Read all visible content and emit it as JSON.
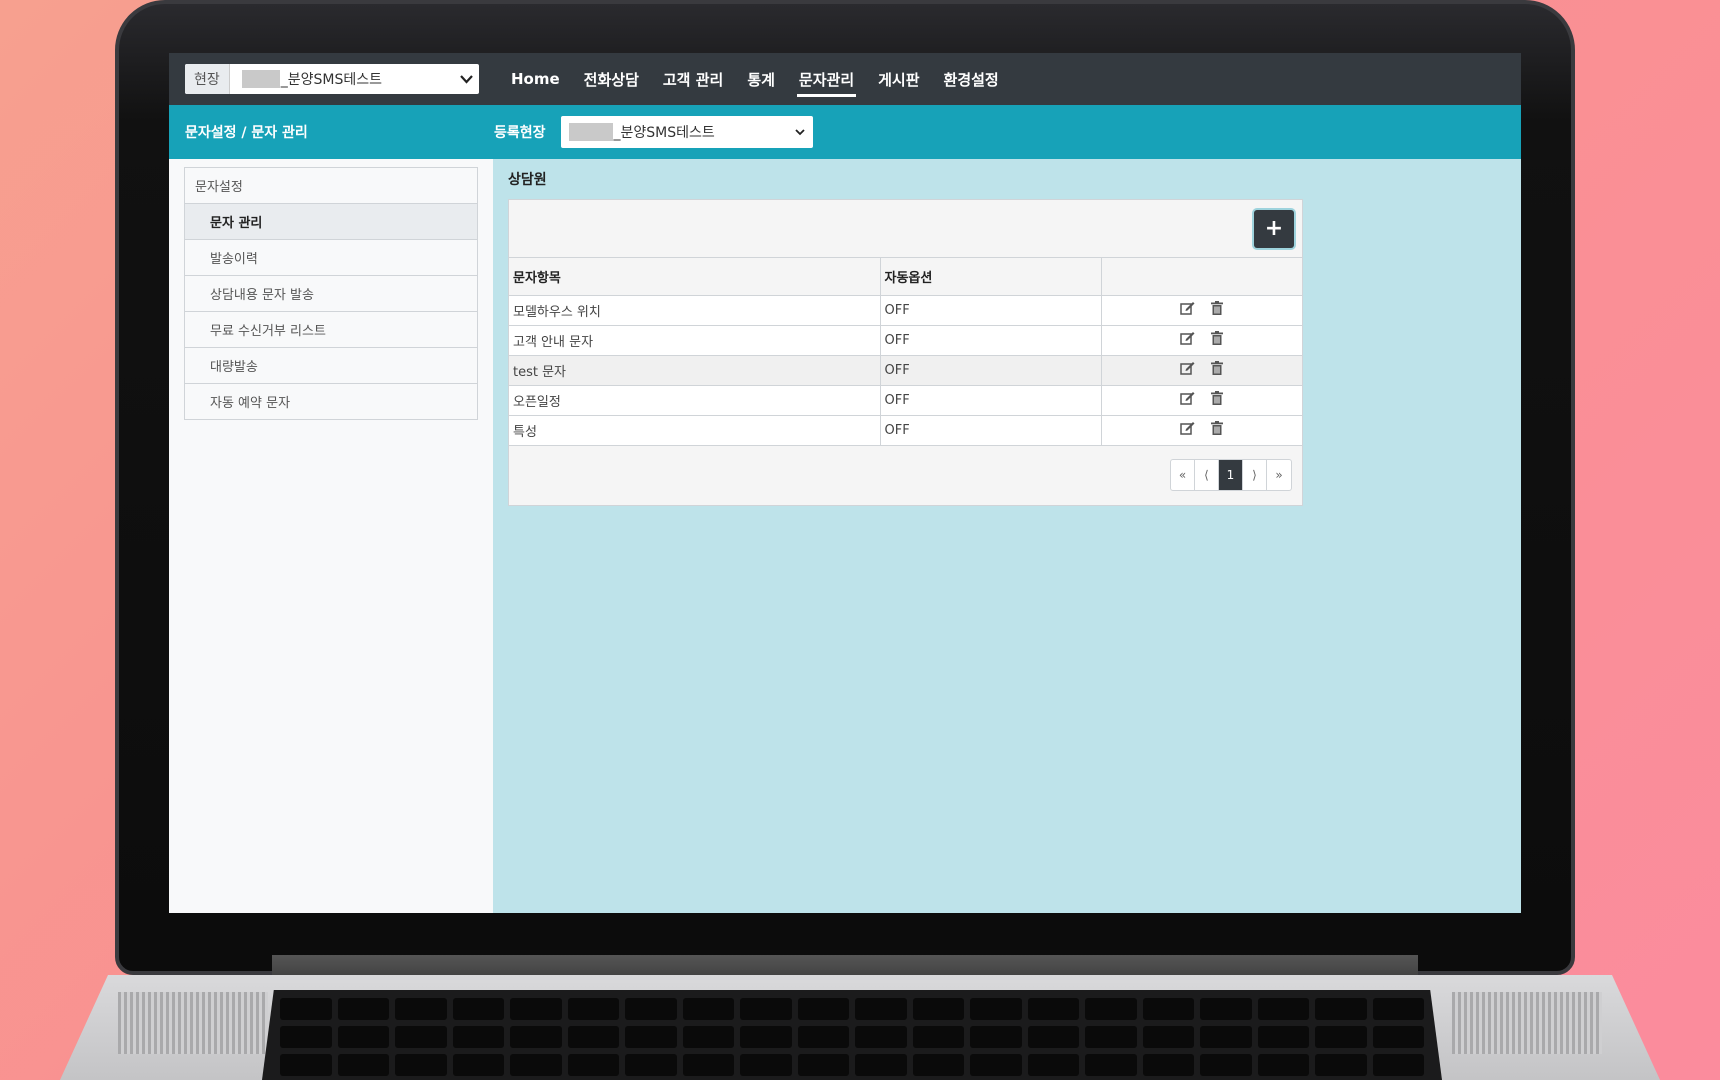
{
  "header": {
    "site_label": "현장",
    "site_value": "_분양SMS테스트",
    "nav": [
      {
        "label": "Home",
        "active": false
      },
      {
        "label": "전화상담",
        "active": false
      },
      {
        "label": "고객 관리",
        "active": false
      },
      {
        "label": "통계",
        "active": false
      },
      {
        "label": "문자관리",
        "active": true
      },
      {
        "label": "게시판",
        "active": false
      },
      {
        "label": "환경설정",
        "active": false
      }
    ]
  },
  "subbar": {
    "breadcrumb": "문자설정 / 문자 관리",
    "reg_label": "등록현장",
    "reg_value": "_분양SMS테스트"
  },
  "sidebar": {
    "heading": "문자설정",
    "items": [
      {
        "label": "문자 관리",
        "active": true
      },
      {
        "label": "발송이력",
        "active": false
      },
      {
        "label": "상담내용 문자 발송",
        "active": false
      },
      {
        "label": "무료 수신거부 리스트",
        "active": false
      },
      {
        "label": "대량발송",
        "active": false
      },
      {
        "label": "자동 예약 문자",
        "active": false
      }
    ]
  },
  "main": {
    "title": "상담원",
    "add_label": "+",
    "columns": [
      "문자항목",
      "자동옵션",
      ""
    ],
    "rows": [
      {
        "item": "모델하우스 위치",
        "option": "OFF"
      },
      {
        "item": "고객 안내 문자",
        "option": "OFF"
      },
      {
        "item": "test 문자",
        "option": "OFF"
      },
      {
        "item": "오픈일정",
        "option": "OFF"
      },
      {
        "item": "특성",
        "option": "OFF"
      }
    ],
    "pager": {
      "first": "«",
      "prev": "⟨",
      "current": "1",
      "next": "⟩",
      "last": "»"
    }
  },
  "colors": {
    "topbar": "#343a40",
    "accent": "#17a2b8",
    "main_bg": "#bee3ea"
  },
  "icons": [
    "edit-icon",
    "trash-icon",
    "chevron-down-icon",
    "plus-icon"
  ]
}
